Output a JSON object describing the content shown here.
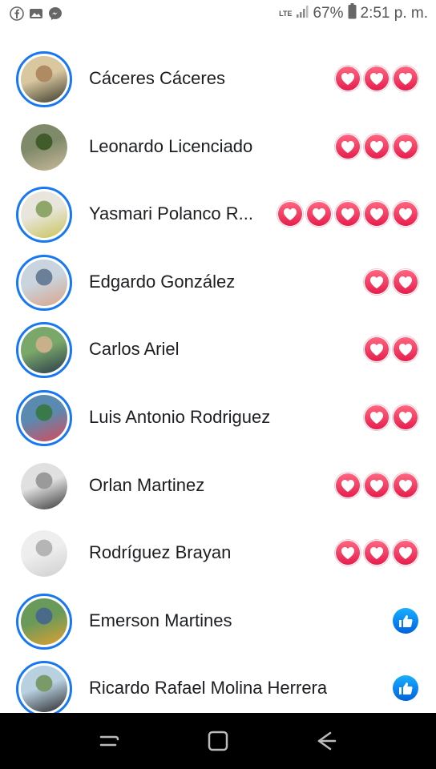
{
  "status_bar": {
    "battery": "67%",
    "time": "2:51 p. m.",
    "network": "LTE",
    "icons": [
      "facebook-icon",
      "gallery-icon",
      "messenger-icon",
      "signal-icon",
      "battery-icon"
    ]
  },
  "people": [
    {
      "name": "Cáceres Cáceres",
      "reaction": "love",
      "count": 3,
      "story_ring": true,
      "colors": [
        "#d9c7a0",
        "#3a3a2a",
        "#b08a62"
      ]
    },
    {
      "name": "Leonardo Licenciado",
      "reaction": "love",
      "count": 3,
      "story_ring": false,
      "colors": [
        "#7f8a6a",
        "#c9b99a",
        "#3f5c2a"
      ]
    },
    {
      "name": "Yasmari Polanco R...",
      "reaction": "love",
      "count": 5,
      "story_ring": true,
      "colors": [
        "#e8e6dc",
        "#c9c35a",
        "#8fa66a"
      ]
    },
    {
      "name": "Edgardo González",
      "reaction": "love",
      "count": 2,
      "story_ring": true,
      "colors": [
        "#c9d4de",
        "#d9a58a",
        "#6a7f98"
      ]
    },
    {
      "name": "Carlos Ariel",
      "reaction": "love",
      "count": 2,
      "story_ring": true,
      "colors": [
        "#7aa86a",
        "#2a3a4a",
        "#c8b08a"
      ]
    },
    {
      "name": "Luis Antonio Rodriguez",
      "reaction": "love",
      "count": 2,
      "story_ring": true,
      "colors": [
        "#5a8ab0",
        "#d94a5a",
        "#3a7a4a"
      ]
    },
    {
      "name": "Orlan Martinez",
      "reaction": "love",
      "count": 3,
      "story_ring": false,
      "colors": [
        "#e0e0e0",
        "#3a3a3a",
        "#9a9a9a"
      ]
    },
    {
      "name": "Rodríguez Brayan",
      "reaction": "love",
      "count": 3,
      "story_ring": false,
      "colors": [
        "#eeeeee",
        "#cfcfcf",
        "#b5b5b5"
      ]
    },
    {
      "name": "Emerson Martines",
      "reaction": "like",
      "count": 1,
      "story_ring": true,
      "colors": [
        "#6a9a5a",
        "#e0a030",
        "#4a6a8a"
      ]
    },
    {
      "name": "Ricardo Rafael Molina Herrera",
      "reaction": "like",
      "count": 1,
      "story_ring": true,
      "colors": [
        "#b8d0e0",
        "#2a2a2a",
        "#7a9a6a"
      ]
    }
  ],
  "nav": [
    "recent-apps-icon",
    "home-icon",
    "back-icon"
  ]
}
